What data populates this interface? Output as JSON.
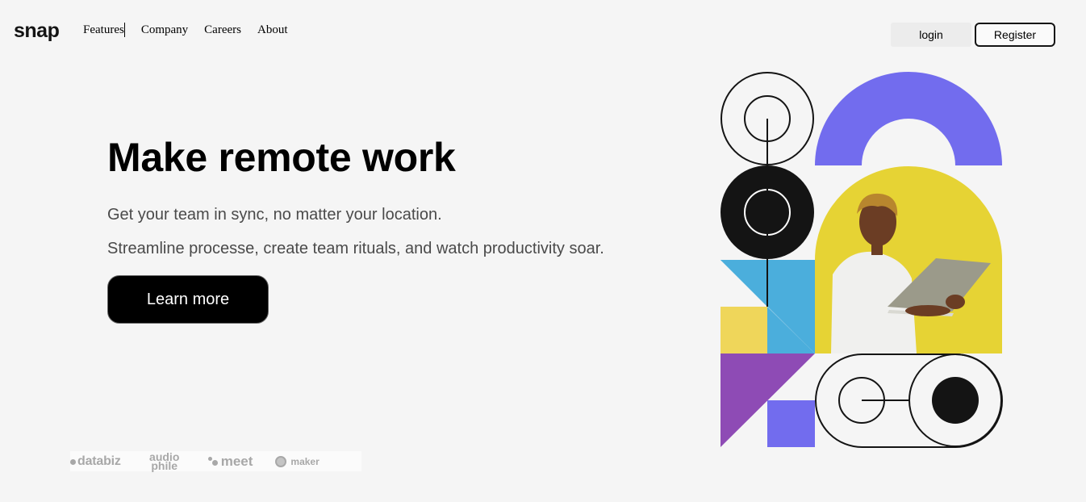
{
  "brand": {
    "logo": "snap"
  },
  "nav": {
    "items": [
      "Features",
      "Company",
      "Careers",
      "About"
    ]
  },
  "auth": {
    "login_label": "login",
    "register_label": "Register"
  },
  "hero": {
    "title": "Make remote work",
    "subtitle_1": "Get your team in sync, no matter your location.",
    "subtitle_2": "Streamline processe, create team rituals, and watch productivity soar.",
    "cta_label": "Learn more"
  },
  "clients": {
    "databiz": "databiz",
    "audiophile_1": "audio",
    "audiophile_2": "phile",
    "meet": "meet",
    "maker": "maker"
  },
  "colors": {
    "purple": "#726cee",
    "yellow": "#e9d735",
    "blue": "#4baedc",
    "violet": "#8e4bb5",
    "pale_yellow": "#efd65a",
    "dark": "#141414"
  }
}
